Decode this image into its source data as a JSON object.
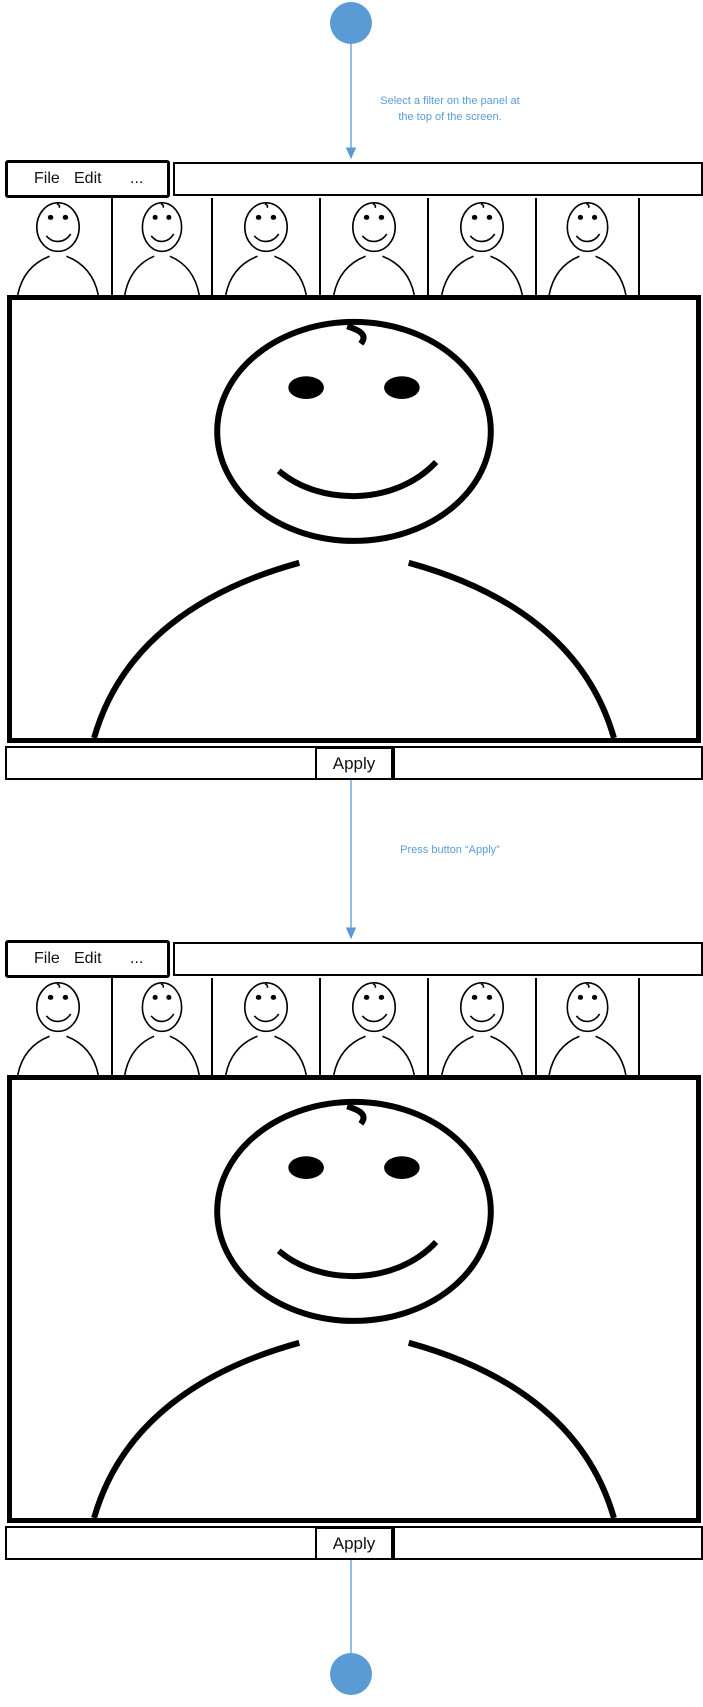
{
  "colors": {
    "accent": "#5b9bd5",
    "outline": "#000000",
    "background": "#ffffff"
  },
  "annotations": [
    {
      "text": "Select a filter on the panel at\nthe top of the screen."
    },
    {
      "text": "Press button “Apply”"
    }
  ],
  "screens": [
    {
      "menu": {
        "file": "File",
        "edit": "Edit",
        "more": "..."
      },
      "thumbnails": [
        "smiley-face",
        "smiley-face",
        "smiley-face",
        "smiley-face",
        "smiley-face",
        "smiley-face"
      ],
      "preview": "smiley-face",
      "apply_label": "Apply"
    },
    {
      "menu": {
        "file": "File",
        "edit": "Edit",
        "more": "..."
      },
      "thumbnails": [
        "smiley-face",
        "smiley-face",
        "smiley-face",
        "smiley-face",
        "smiley-face",
        "smiley-face"
      ],
      "preview": "smiley-face",
      "apply_label": "Apply"
    }
  ],
  "nodes": {
    "start": "start-node",
    "end": "end-node"
  }
}
